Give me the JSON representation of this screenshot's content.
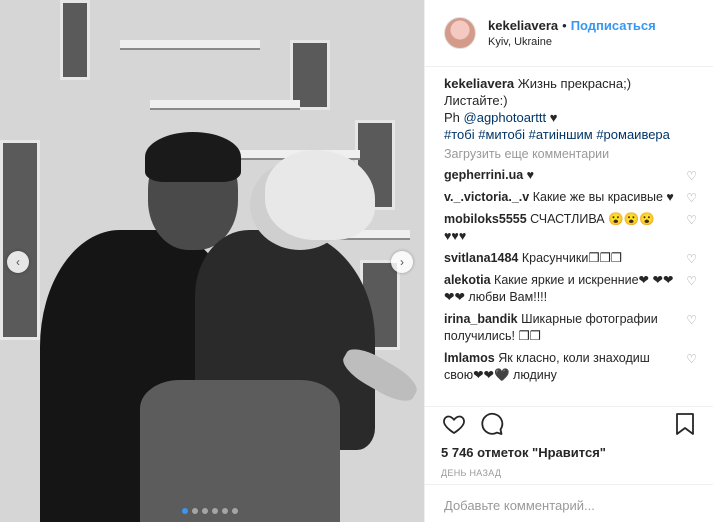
{
  "header": {
    "username": "kekeliavera",
    "separator": "•",
    "follow_label": "Подписаться",
    "location": "Kyiv, Ukraine"
  },
  "caption": {
    "username": "kekeliavera",
    "line1": " Жизнь прекрасна;)",
    "line2": "Листайте:)",
    "line3_prefix": "Ph ",
    "line3_mention": "@agphotoarttt",
    "line3_suffix": " ♥",
    "hashtags": "#тобі #митобі #атиіншим #ромаивера"
  },
  "load_more_label": "Загрузить еще комментарии",
  "comments": [
    {
      "username": "gepherrini.ua",
      "text": " ♥"
    },
    {
      "username": "v._.victoria._.v",
      "text": " Какие же вы красивые ♥"
    },
    {
      "username": "mobiloks5555",
      "text": " СЧАСТЛИВА 😮😮😮♥♥♥"
    },
    {
      "username": "svitlana1484",
      "text": " Красунчики❒❒❒"
    },
    {
      "username": "alekotia",
      "text": " Какие яркие и искренние❤ ❤❤❤❤ любви Вам!!!!"
    },
    {
      "username": "irina_bandik",
      "text": " Шикарные фотографии получились! ❒❒"
    },
    {
      "username": "lmlamos",
      "text": " Як класно, коли знаходиш свою❤❤🖤 людину"
    }
  ],
  "likes_text": "5 746 отметок \"Нравится\"",
  "time_text": "ДЕНЬ НАЗАД",
  "comment_input": {
    "placeholder": "Добавьте комментарий..."
  },
  "icons": {
    "like": "heart-icon",
    "comment": "speech-bubble-icon",
    "share": "share-icon",
    "save": "bookmark-icon"
  },
  "colors": {
    "accent": "#3897f0",
    "text": "#262626",
    "muted": "#999999"
  },
  "carousel": {
    "total_slides": 6,
    "active_slide": 1
  }
}
